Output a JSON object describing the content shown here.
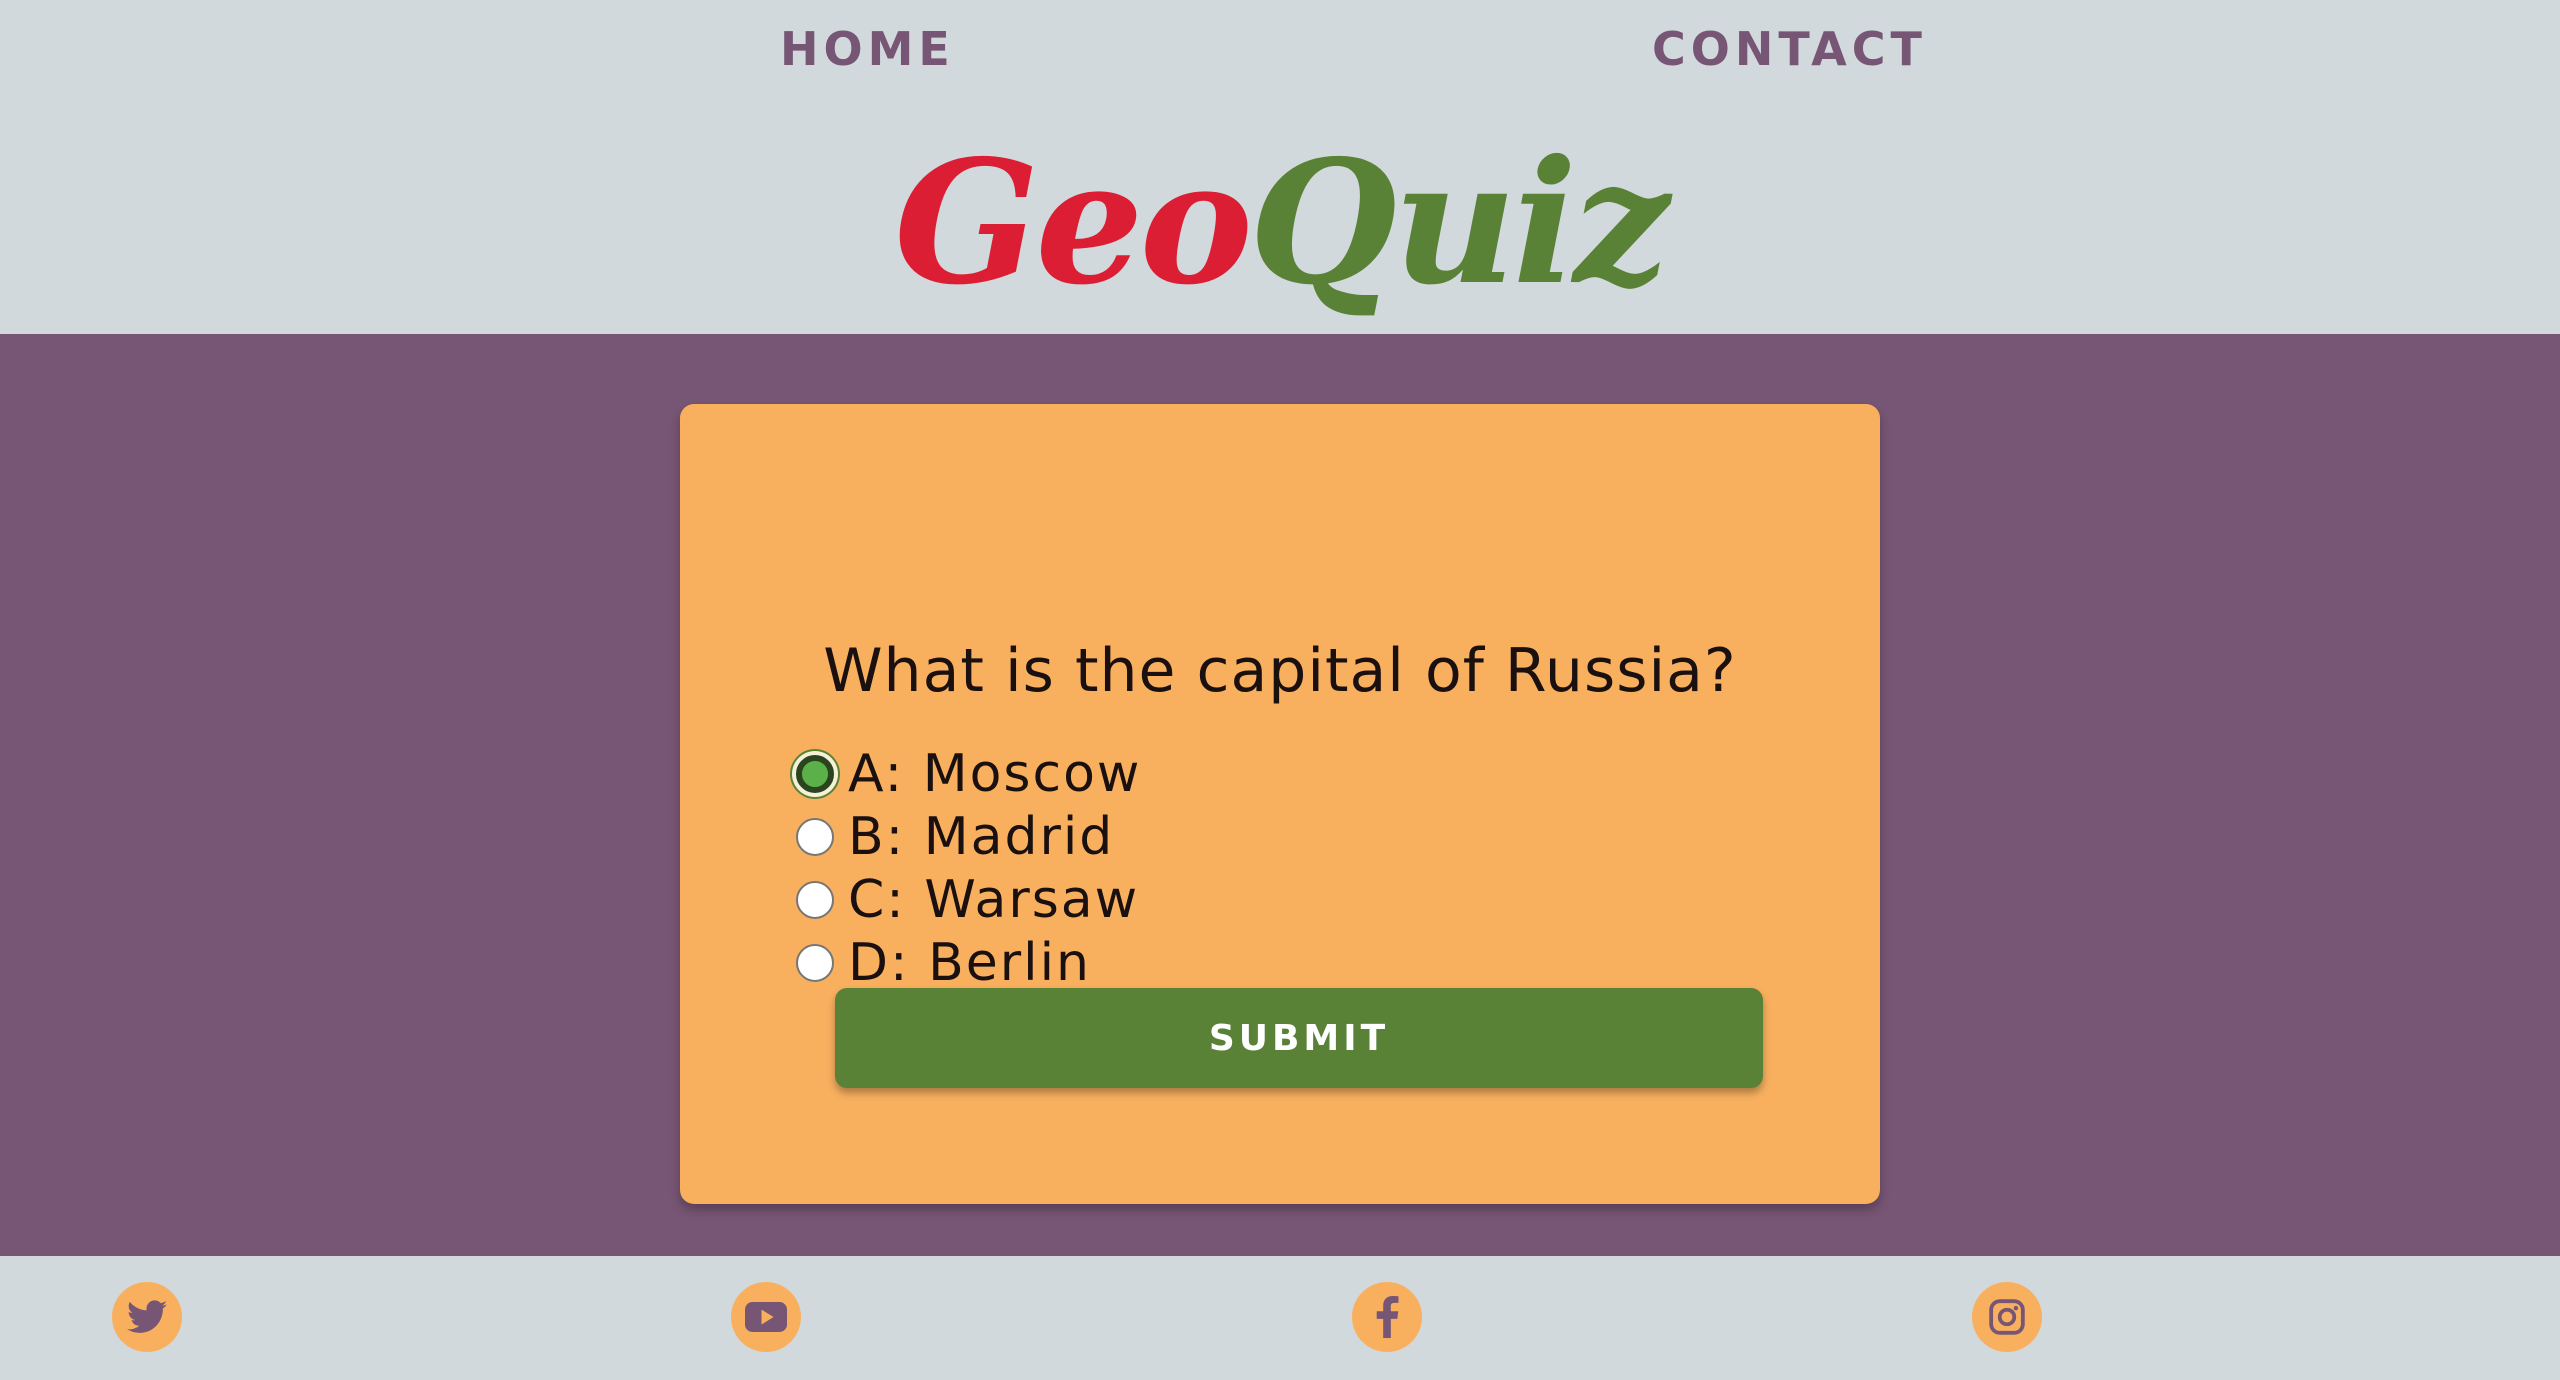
{
  "nav": {
    "home_label": "HOME",
    "contact_label": "CONTACT"
  },
  "logo": {
    "part1": "Geo",
    "part2": "Quiz"
  },
  "quiz": {
    "question": "What is the capital of Russia?",
    "options": [
      {
        "label": "A: Moscow",
        "checked": true
      },
      {
        "label": "B: Madrid",
        "checked": false
      },
      {
        "label": "C: Warsaw",
        "checked": false
      },
      {
        "label": "D: Berlin",
        "checked": false
      }
    ],
    "submit_label": "SUBMIT"
  },
  "footer": {
    "social_icons": [
      "twitter-icon",
      "youtube-icon",
      "facebook-icon",
      "instagram-icon"
    ]
  },
  "colors": {
    "background_light": "#d1d9dd",
    "background_main": "#775574",
    "card": "#f8b05f",
    "accent_green": "#5a8236",
    "accent_red": "#dc1e34",
    "nav_text": "#775574"
  }
}
